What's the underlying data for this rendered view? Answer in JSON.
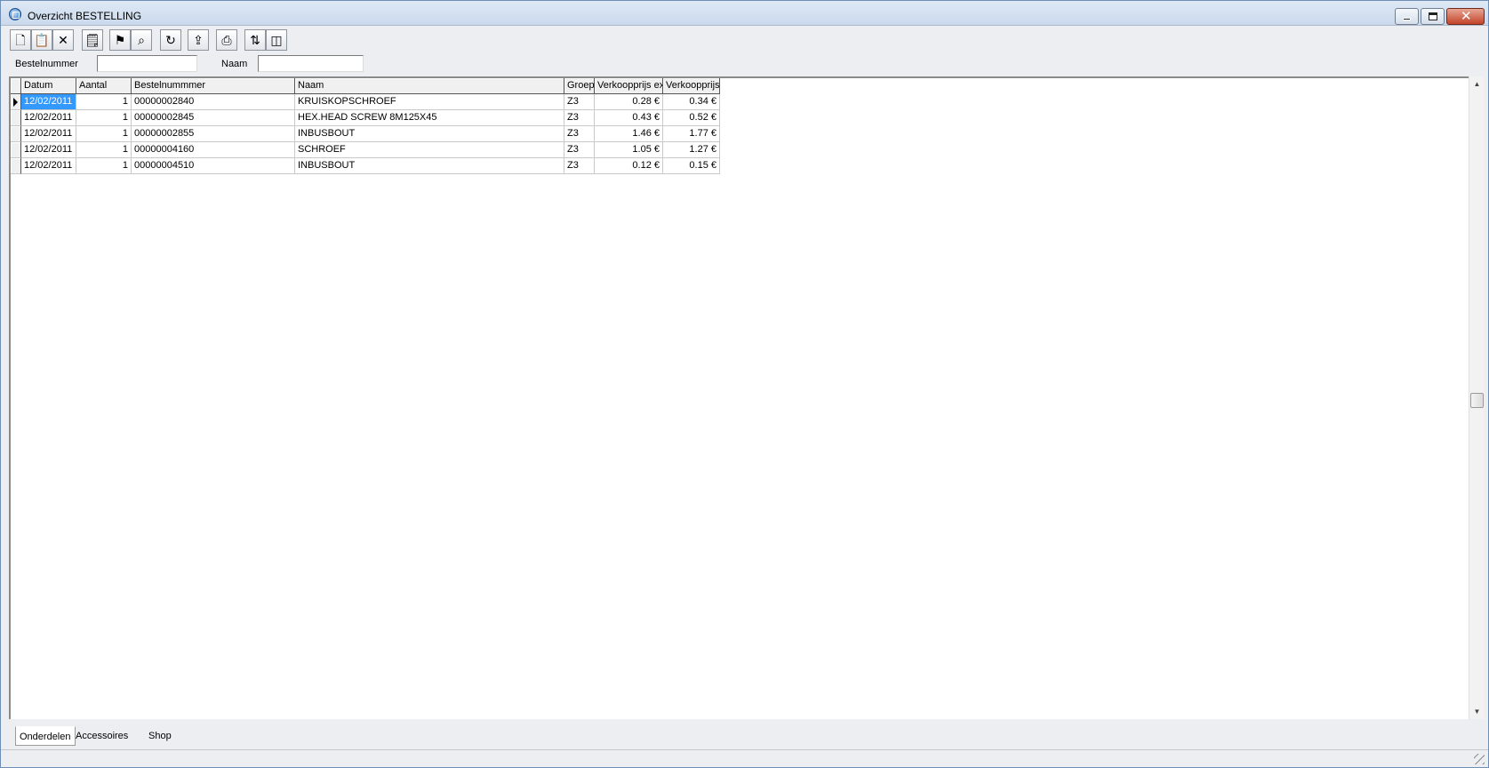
{
  "window": {
    "title": "Overzicht BESTELLING"
  },
  "toolbar": {
    "buttons": [
      {
        "name": "new-button",
        "icon": "new-document-icon",
        "glyph": "🗋"
      },
      {
        "name": "open-button",
        "icon": "open-record-icon",
        "glyph": "📋"
      },
      {
        "name": "delete-button",
        "icon": "delete-x-icon",
        "glyph": "✕"
      },
      {
        "name": "properties-button",
        "icon": "properties-icon",
        "glyph": "🗒"
      },
      {
        "name": "filter-button",
        "icon": "filter-icon",
        "glyph": "⚑"
      },
      {
        "name": "find-button",
        "icon": "binoculars-icon",
        "glyph": "⌕"
      },
      {
        "name": "refresh-button",
        "icon": "refresh-icon",
        "glyph": "↻"
      },
      {
        "name": "export-button",
        "icon": "export-icon",
        "glyph": "⇪"
      },
      {
        "name": "print-button",
        "icon": "printer-icon",
        "glyph": "⎙"
      },
      {
        "name": "sort-button",
        "icon": "sort-az-icon",
        "glyph": "⇅"
      },
      {
        "name": "columns-button",
        "icon": "columns-icon",
        "glyph": "◫"
      }
    ]
  },
  "filters": {
    "bestelnummer_label": "Bestelnummer",
    "bestelnummer_value": "",
    "naam_label": "Naam",
    "naam_value": ""
  },
  "grid": {
    "columns": [
      "Datum",
      "Aantal",
      "Bestelnummmer",
      "Naam",
      "Groep",
      "Verkoopprijs ex",
      "Verkoopprijs"
    ],
    "rows": [
      [
        "12/02/2011",
        "1",
        "00000002840",
        "KRUISKOPSCHROEF",
        "Z3",
        "0.28 €",
        "0.34 €"
      ],
      [
        "12/02/2011",
        "1",
        "00000002845",
        "HEX.HEAD SCREW 8M125X45",
        "Z3",
        "0.43 €",
        "0.52 €"
      ],
      [
        "12/02/2011",
        "1",
        "00000002855",
        "INBUSBOUT",
        "Z3",
        "1.46 €",
        "1.77 €"
      ],
      [
        "12/02/2011",
        "1",
        "00000004160",
        "SCHROEF",
        "Z3",
        "1.05 €",
        "1.27 €"
      ],
      [
        "12/02/2011",
        "1",
        "00000004510",
        "INBUSBOUT",
        "Z3",
        "0.12 €",
        "0.15 €"
      ]
    ],
    "selected_row": 0,
    "selected_column": 0
  },
  "tabs": [
    {
      "label": "Onderdelen",
      "active": true
    },
    {
      "label": "Accessoires",
      "active": false
    },
    {
      "label": "Shop",
      "active": false
    }
  ]
}
